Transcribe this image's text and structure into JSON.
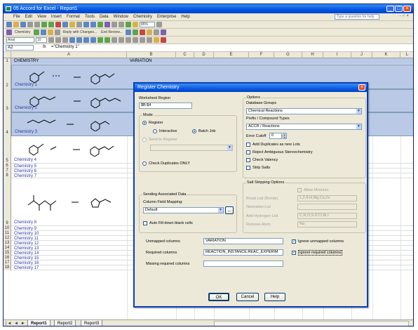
{
  "window": {
    "title": "05 Accord for Excel - Report1",
    "controls": [
      "_",
      "□",
      "×"
    ]
  },
  "menu": {
    "items": [
      "File",
      "Edit",
      "View",
      "Insert",
      "Format",
      "Tools",
      "Data",
      "Window",
      "Chemistry",
      "Enterprise",
      "Help"
    ],
    "ask_placeholder": "Type a question for help",
    "mini": "- ♂ ×"
  },
  "toolbar": {
    "zoom": "85%",
    "chemistry_label": "Chemistry",
    "reply_text": "Reply with Changes...",
    "end_review": "End Review...",
    "font_name": "Arial",
    "font_size": "10"
  },
  "formula_bar": {
    "name_box": "A2",
    "fx": "fx",
    "value": "=\"Chemistry 1\""
  },
  "columns": [
    "A",
    "B",
    "C",
    "D",
    "E",
    "F",
    "G",
    "H",
    "I",
    "J",
    "K",
    "L"
  ],
  "sheet": {
    "header_row": {
      "num": "1",
      "col_a": "CHEMISTRY",
      "col_b": "VARIATION"
    },
    "rows": [
      {
        "num": "2",
        "label": "Chemistry 1"
      },
      {
        "num": "3",
        "label": "Chemistry 2"
      },
      {
        "num": "4",
        "label": "Chemistry 3"
      },
      {
        "num": "5",
        "label": "Chemistry 4"
      },
      {
        "num": "6",
        "label": "Chemistry 5"
      },
      {
        "num": "7",
        "label": "Chemistry 6"
      },
      {
        "num": "8",
        "label": "Chemistry 7"
      },
      {
        "num": "9",
        "label": "Chemistry 8"
      },
      {
        "num": "10",
        "label": "Chemistry 9"
      },
      {
        "num": "11",
        "label": "Chemistry 10"
      },
      {
        "num": "12",
        "label": "Chemistry 11"
      },
      {
        "num": "13",
        "label": "Chemistry 12"
      },
      {
        "num": "14",
        "label": "Chemistry 13"
      },
      {
        "num": "15",
        "label": "Chemistry 14"
      },
      {
        "num": "16",
        "label": "Chemistry 15"
      },
      {
        "num": "17",
        "label": "Chemistry 16"
      },
      {
        "num": "18",
        "label": "Chemistry 17"
      }
    ],
    "tabs": [
      "Report1",
      "Report2",
      "Report3"
    ],
    "tab_nav": "|◄ ◄ ► ►|"
  },
  "dialog": {
    "title": "Register Chemistry",
    "close": "×",
    "worksheet_region_label": "Worksheet Region",
    "worksheet_region_value": "$B:$4",
    "mode": {
      "label": "Mode",
      "register": "Register",
      "interactive": "Interactive",
      "batch": "Batch Job",
      "send_to_register": "Send to Register",
      "check_duplicates": "Check Duplicates ONLY"
    },
    "sending": {
      "label": "Sending Associated Data",
      "column_field_mapping": "Column Field Mapping:",
      "mapping_value": "Default",
      "browse": "...",
      "auto_fill": "Auto Fill down blank cells"
    },
    "options": {
      "label": "Options",
      "database_groups": "Database Groups",
      "database_value": "Chemical Reactions",
      "prefix_label": "Prefix / Compound Types",
      "prefix_value": "ACCR / Reactions",
      "error_cutoff": "Error Cutoff",
      "error_value": "0",
      "add_duplicates": "Add Duplicates as new Lots",
      "reject_ambiguous": "Reject Ambiguous Stereochemistry",
      "check_valency": "Check Valency",
      "strip_salts": "Strip Salts"
    },
    "salt": {
      "label": "Salt Stripping Options",
      "allow_mixtures": "Allow Mixtures",
      "break_list_label": "Break List (Bonds)",
      "break_list_value": "1,2,4-H,Mg,Ca,Zn",
      "neutralize_label": "Neutralize List",
      "neutralize_value": "",
      "add_hydrogen_label": "Add Hydrogen List",
      "add_hydrogen_value": "C,N,O,S,P,CI,Br,I",
      "remove_atom_label": "Remove Atom",
      "remove_atom_value": "Na"
    },
    "columns": {
      "unmapped_label": "Unmapped columns",
      "unmapped_value": "VARIATION",
      "required_label": "Required columns",
      "required_value": "REACTION_INSTANCE.REAC_EXPERIM",
      "missing_label": "Missing required columns",
      "missing_value": "",
      "ignore_unmapped": "Ignore unmapped columns",
      "ignore_required": "Ignore required columns"
    },
    "buttons": {
      "ok": "OK",
      "cancel": "Cancel",
      "help": "Help"
    }
  },
  "colors": {
    "title_bar": "#0055e5",
    "selection": "#b9c9e6",
    "dialog_bg": "#ece9d8",
    "link_text": "#2a3aa5"
  }
}
